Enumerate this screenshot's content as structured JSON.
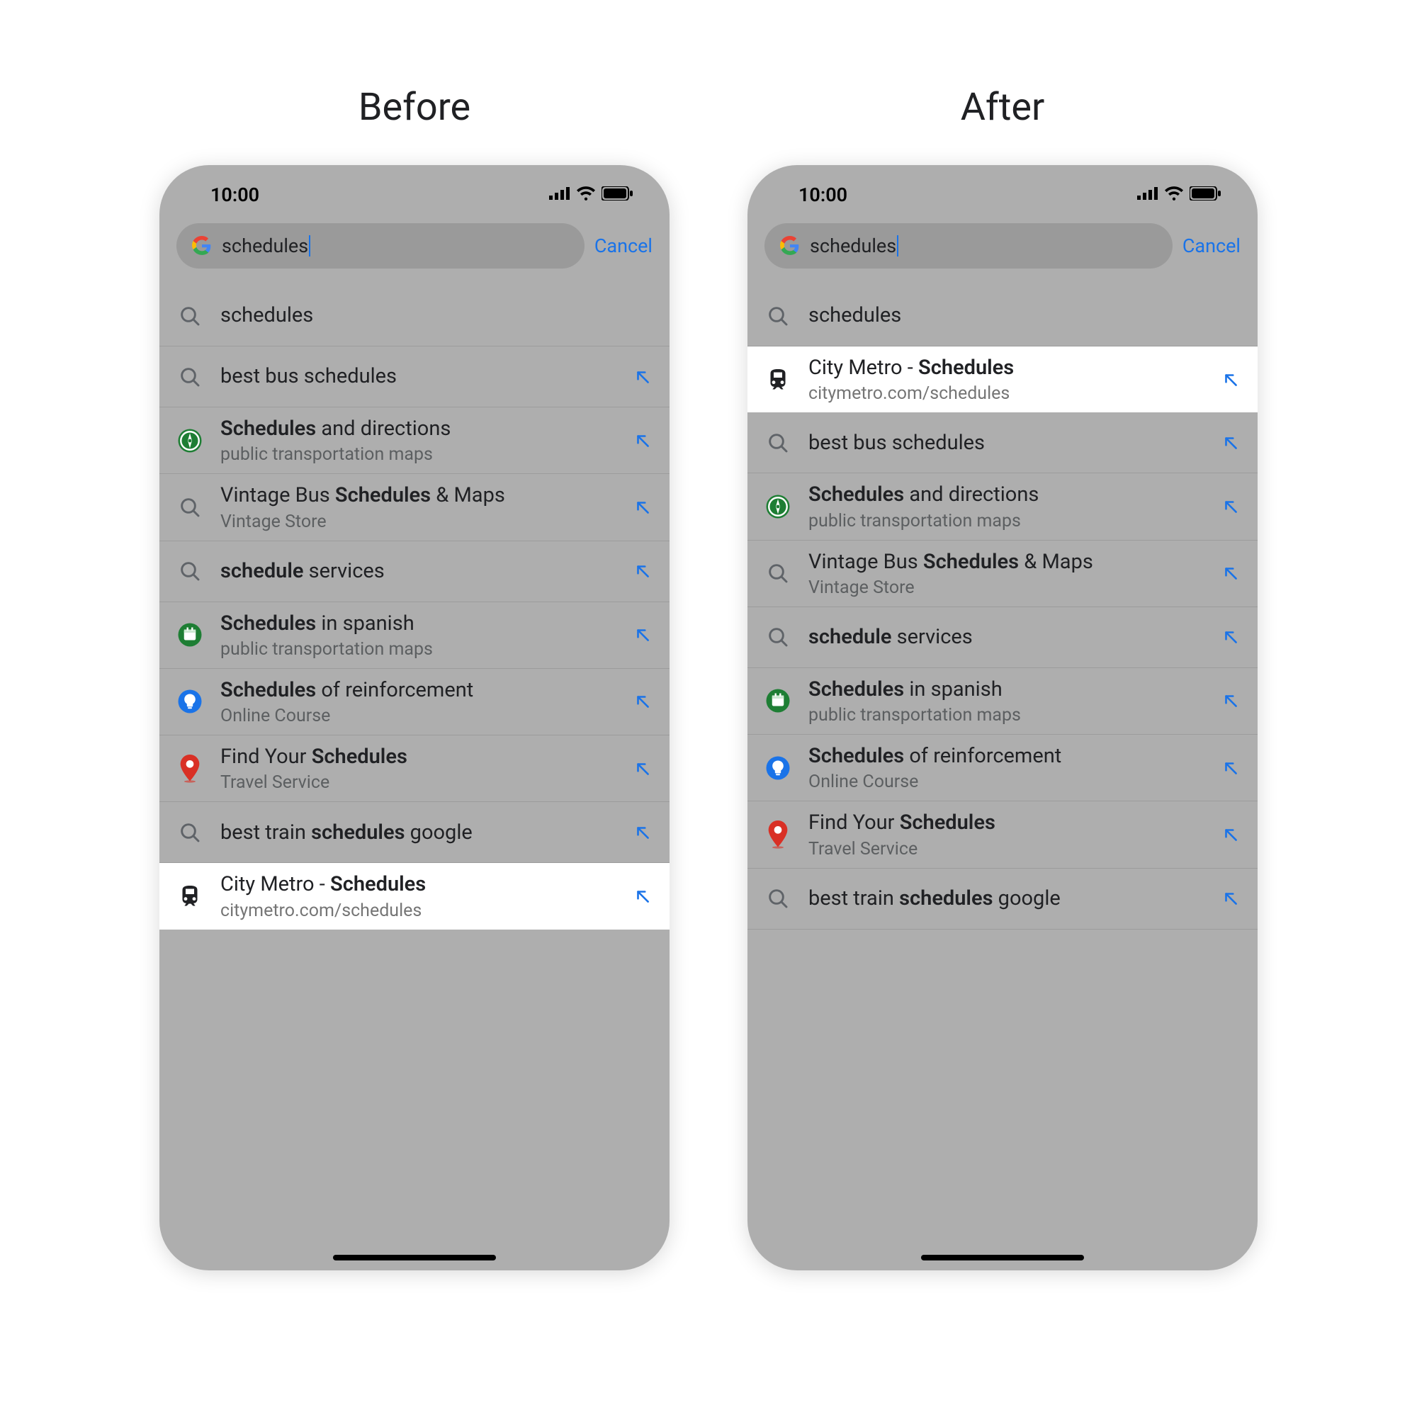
{
  "headings": {
    "before": "Before",
    "after": "After"
  },
  "status": {
    "time": "10:00"
  },
  "search": {
    "query": "schedules",
    "cancel": "Cancel"
  },
  "icons": {
    "search": "search-icon",
    "compass": "compass-icon",
    "calendar": "calendar-icon",
    "bulb": "bulb-icon",
    "pin": "pin-icon",
    "train": "train-icon"
  },
  "before": [
    {
      "icon": "search",
      "segs": [
        {
          "t": "schedules",
          "b": false
        }
      ],
      "arrow": false
    },
    {
      "icon": "search",
      "segs": [
        {
          "t": "best bus schedules",
          "b": false
        }
      ],
      "arrow": true
    },
    {
      "icon": "compass",
      "segs": [
        {
          "t": "Schedules",
          "b": true
        },
        {
          "t": " and directions",
          "b": false
        }
      ],
      "sub": "public transportation maps",
      "arrow": true
    },
    {
      "icon": "search",
      "segs": [
        {
          "t": "Vintage Bus ",
          "b": false
        },
        {
          "t": "Schedules",
          "b": true
        },
        {
          "t": " & Maps",
          "b": false
        }
      ],
      "sub": "Vintage Store",
      "arrow": true
    },
    {
      "icon": "search",
      "segs": [
        {
          "t": "schedule",
          "b": true
        },
        {
          "t": " services",
          "b": false
        }
      ],
      "arrow": true
    },
    {
      "icon": "calendar",
      "segs": [
        {
          "t": "Schedules",
          "b": true
        },
        {
          "t": " in spanish",
          "b": false
        }
      ],
      "sub": "public transportation maps",
      "arrow": true
    },
    {
      "icon": "bulb",
      "segs": [
        {
          "t": "Schedules",
          "b": true
        },
        {
          "t": " of reinforcement",
          "b": false
        }
      ],
      "sub": "Online Course",
      "arrow": true
    },
    {
      "icon": "pin",
      "segs": [
        {
          "t": "Find Your ",
          "b": false
        },
        {
          "t": "Schedules",
          "b": true
        }
      ],
      "sub": "Travel Service",
      "arrow": true
    },
    {
      "icon": "search",
      "segs": [
        {
          "t": "best train ",
          "b": false
        },
        {
          "t": "schedules",
          "b": true
        },
        {
          "t": " google",
          "b": false
        }
      ],
      "arrow": true
    },
    {
      "icon": "train",
      "segs": [
        {
          "t": "City Metro -  ",
          "b": false
        },
        {
          "t": "Schedules",
          "b": true
        }
      ],
      "sub": "citymetro.com/schedules",
      "arrow": true,
      "highlight": true
    }
  ],
  "after": [
    {
      "icon": "search",
      "segs": [
        {
          "t": "schedules",
          "b": false
        }
      ],
      "arrow": false
    },
    {
      "icon": "train",
      "segs": [
        {
          "t": "City Metro -  ",
          "b": false
        },
        {
          "t": "Schedules",
          "b": true
        }
      ],
      "sub": "citymetro.com/schedules",
      "arrow": true,
      "highlight": true
    },
    {
      "icon": "search",
      "segs": [
        {
          "t": "best bus schedules",
          "b": false
        }
      ],
      "arrow": true
    },
    {
      "icon": "compass",
      "segs": [
        {
          "t": "Schedules",
          "b": true
        },
        {
          "t": " and directions",
          "b": false
        }
      ],
      "sub": "public transportation maps",
      "arrow": true
    },
    {
      "icon": "search",
      "segs": [
        {
          "t": "Vintage Bus ",
          "b": false
        },
        {
          "t": "Schedules",
          "b": true
        },
        {
          "t": " & Maps",
          "b": false
        }
      ],
      "sub": "Vintage Store",
      "arrow": true
    },
    {
      "icon": "search",
      "segs": [
        {
          "t": "schedule",
          "b": true
        },
        {
          "t": " services",
          "b": false
        }
      ],
      "arrow": true
    },
    {
      "icon": "calendar",
      "segs": [
        {
          "t": "Schedules",
          "b": true
        },
        {
          "t": " in spanish",
          "b": false
        }
      ],
      "sub": "public transportation maps",
      "arrow": true
    },
    {
      "icon": "bulb",
      "segs": [
        {
          "t": "Schedules",
          "b": true
        },
        {
          "t": " of reinforcement",
          "b": false
        }
      ],
      "sub": "Online Course",
      "arrow": true
    },
    {
      "icon": "pin",
      "segs": [
        {
          "t": "Find Your ",
          "b": false
        },
        {
          "t": "Schedules",
          "b": true
        }
      ],
      "sub": "Travel Service",
      "arrow": true
    },
    {
      "icon": "search",
      "segs": [
        {
          "t": "best train ",
          "b": false
        },
        {
          "t": "schedules",
          "b": true
        },
        {
          "t": " google",
          "b": false
        }
      ],
      "arrow": true
    }
  ]
}
